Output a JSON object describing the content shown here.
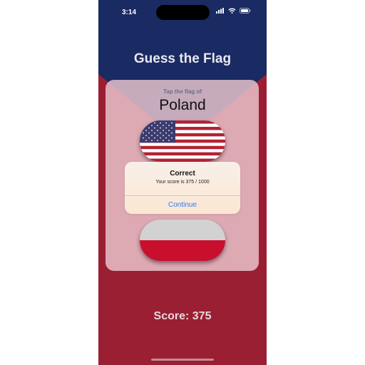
{
  "status_bar": {
    "time": "3:14",
    "icons": [
      "cellular-signal-icon",
      "wifi-icon",
      "battery-icon"
    ]
  },
  "app": {
    "title": "Guess the Flag",
    "prompt": "Tap the flag of",
    "country": "Poland",
    "score_label": "Score: 375"
  },
  "flags": [
    {
      "country": "United States",
      "icon": "us-flag"
    },
    {
      "country": "Poland",
      "icon": "poland-flag"
    }
  ],
  "alert": {
    "title": "Correct",
    "message": "Your score is 375 / 1000",
    "button": "Continue"
  },
  "colors": {
    "navy": "#1a2a63",
    "crimson": "#9a1f33",
    "alert_button": "#2e7bf6"
  }
}
